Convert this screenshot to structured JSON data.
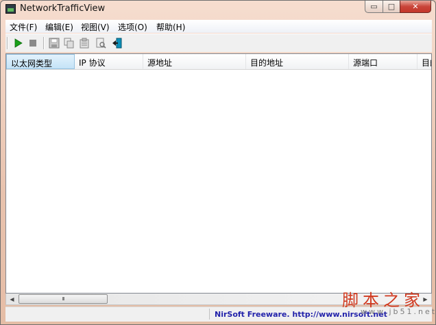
{
  "window": {
    "title": "NetworkTrafficView"
  },
  "window_controls": {
    "minimize": "▭",
    "maximize": "□",
    "close": "✕"
  },
  "menu": [
    "文件(F)",
    "编辑(E)",
    "视图(V)",
    "选项(O)",
    "帮助(H)"
  ],
  "toolbar": {
    "buttons": [
      {
        "name": "start-capture-icon",
        "color": "#1aa01a"
      },
      {
        "name": "stop-capture-icon",
        "color": "#8a8a8a"
      },
      {
        "name": "save-icon",
        "color": "#8a8a8a"
      },
      {
        "name": "copy-icon",
        "color": "#8a8a8a"
      },
      {
        "name": "properties-icon",
        "color": "#8a8a8a"
      },
      {
        "name": "find-icon",
        "color": "#8a8a8a"
      },
      {
        "name": "exit-icon",
        "color": "#0b8fb8"
      }
    ]
  },
  "table": {
    "columns": [
      "以太网类型",
      "IP 协议",
      "源地址",
      "目的地址",
      "源端口",
      "目的"
    ],
    "rows": []
  },
  "scrollbar": {
    "thumb_grip": "III",
    "left_arrow": "◀",
    "right_arrow": "▶"
  },
  "status": {
    "link_text": "NirSoft Freeware.  http://www.nirsoft.net"
  },
  "watermark": {
    "brand": "脚本之家",
    "url": "www.jb51.net"
  }
}
